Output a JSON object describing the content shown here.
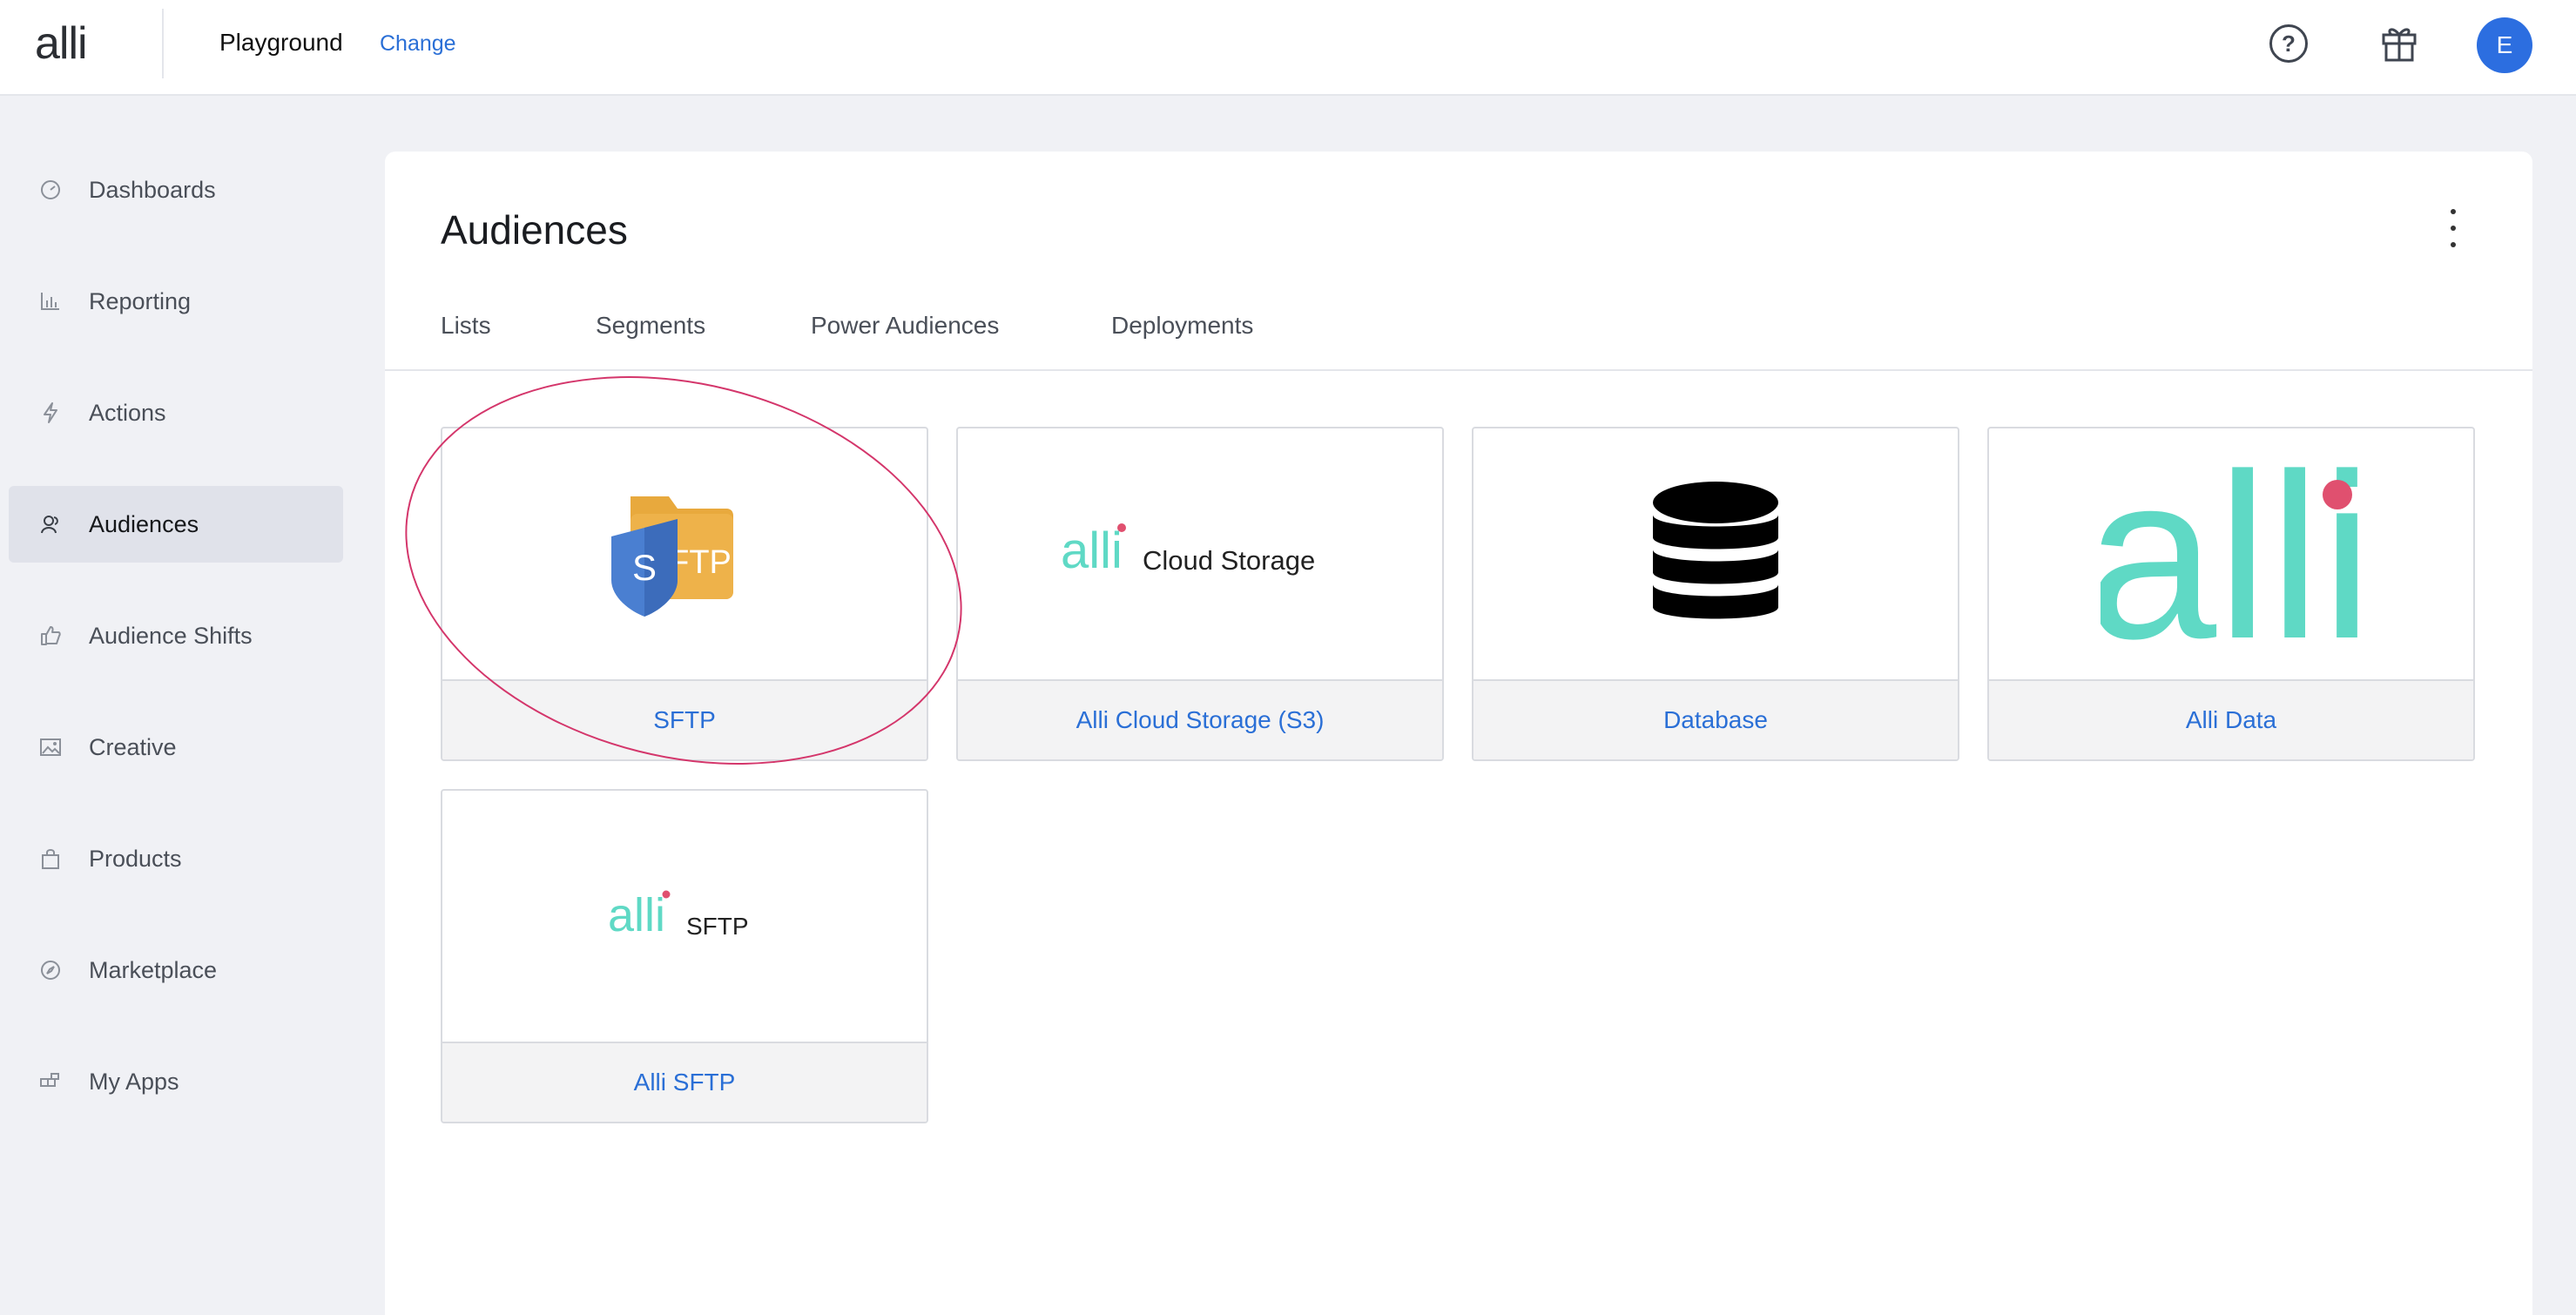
{
  "app": {
    "logo": "alli",
    "workspace": "Playground",
    "change_label": "Change"
  },
  "header": {
    "help_icon": "help-circle-icon",
    "gift_icon": "gift-icon",
    "avatar_initial": "E"
  },
  "sidebar": {
    "items": [
      {
        "label": "Dashboards",
        "icon": "gauge-icon"
      },
      {
        "label": "Reporting",
        "icon": "bar-chart-icon"
      },
      {
        "label": "Actions",
        "icon": "lightning-icon"
      },
      {
        "label": "Audiences",
        "icon": "audience-icon",
        "active": true
      },
      {
        "label": "Audience Shifts",
        "icon": "thumbs-up-icon"
      },
      {
        "label": "Creative",
        "icon": "image-icon"
      },
      {
        "label": "Products",
        "icon": "shopping-bag-icon"
      },
      {
        "label": "Marketplace",
        "icon": "compass-icon"
      },
      {
        "label": "My Apps",
        "icon": "apps-icon"
      }
    ]
  },
  "main": {
    "title": "Audiences",
    "menu_icon": "kebab-menu-icon",
    "tabs": [
      {
        "label": "Lists"
      },
      {
        "label": "Segments"
      },
      {
        "label": "Power Audiences"
      },
      {
        "label": "Deployments"
      }
    ],
    "cards": [
      {
        "label": "SFTP",
        "logo_text": "S FTP"
      },
      {
        "label": "Alli Cloud Storage (S3)",
        "logo_text": "alli Cloud Storage"
      },
      {
        "label": "Database",
        "logo_icon": "database-icon"
      },
      {
        "label": "Alli Data",
        "logo_text": "alli"
      },
      {
        "label": "Alli SFTP",
        "logo_text": "alli SFTP"
      }
    ]
  },
  "colors": {
    "accent_blue": "#2a6fd6",
    "alli_teal": "#5fd9c5",
    "alli_pink": "#e0506f",
    "annotation": "#d4366b",
    "sftp_folder": "#e8a93d",
    "sftp_shield": "#4a7fd1"
  }
}
